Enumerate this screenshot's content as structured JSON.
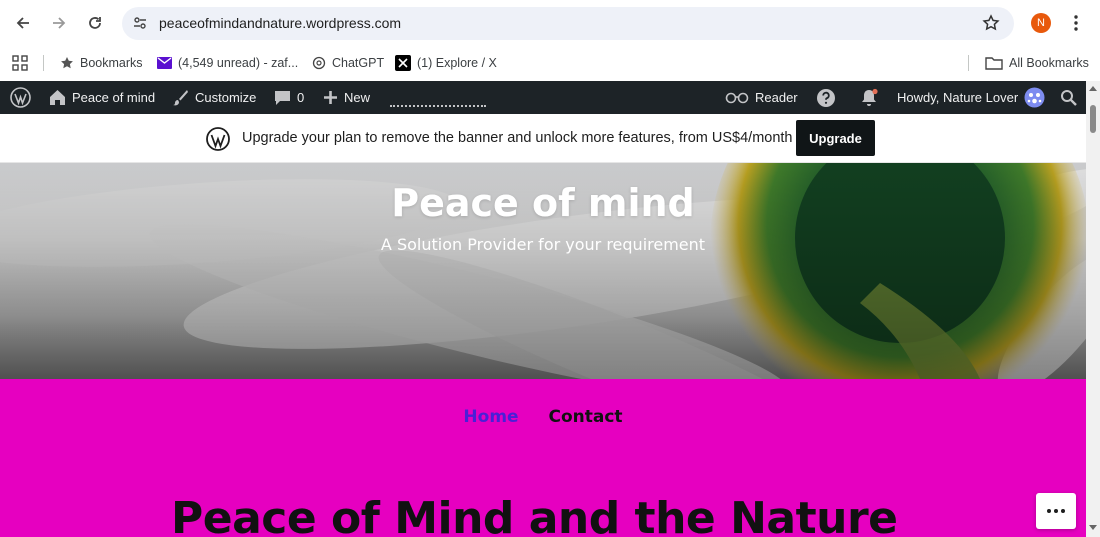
{
  "browser": {
    "url": "peaceofmindandnature.wordpress.com",
    "profile_initial": "N",
    "profile_color": "#e8590c"
  },
  "bookmarks": {
    "items": [
      {
        "label": "Bookmarks",
        "icon": "star-icon"
      },
      {
        "label": "(4,549 unread) - zaf...",
        "icon": "mail-icon"
      },
      {
        "label": "ChatGPT",
        "icon": "chatgpt-icon"
      },
      {
        "label": "(1) Explore / X",
        "icon": "x-logo-icon"
      }
    ],
    "all_bookmarks": "All Bookmarks"
  },
  "admin_bar": {
    "site_name": "Peace of mind",
    "customize": "Customize",
    "comments_count": "0",
    "new": "New",
    "reader": "Reader",
    "howdy": "Howdy, Nature Lover"
  },
  "banner": {
    "text": "Upgrade your plan to remove the banner and unlock more features, from US$4/month",
    "button": "Upgrade"
  },
  "site": {
    "title": "Peace of mind",
    "tagline": "A Solution Provider for your requirement"
  },
  "nav": {
    "home": "Home",
    "contact": "Contact"
  },
  "page": {
    "heading": "Peace of Mind and the Nature"
  },
  "colors": {
    "admin_bar": "#1d2327",
    "content_bg": "#e600c0",
    "nav_active": "#4b1fd6"
  }
}
